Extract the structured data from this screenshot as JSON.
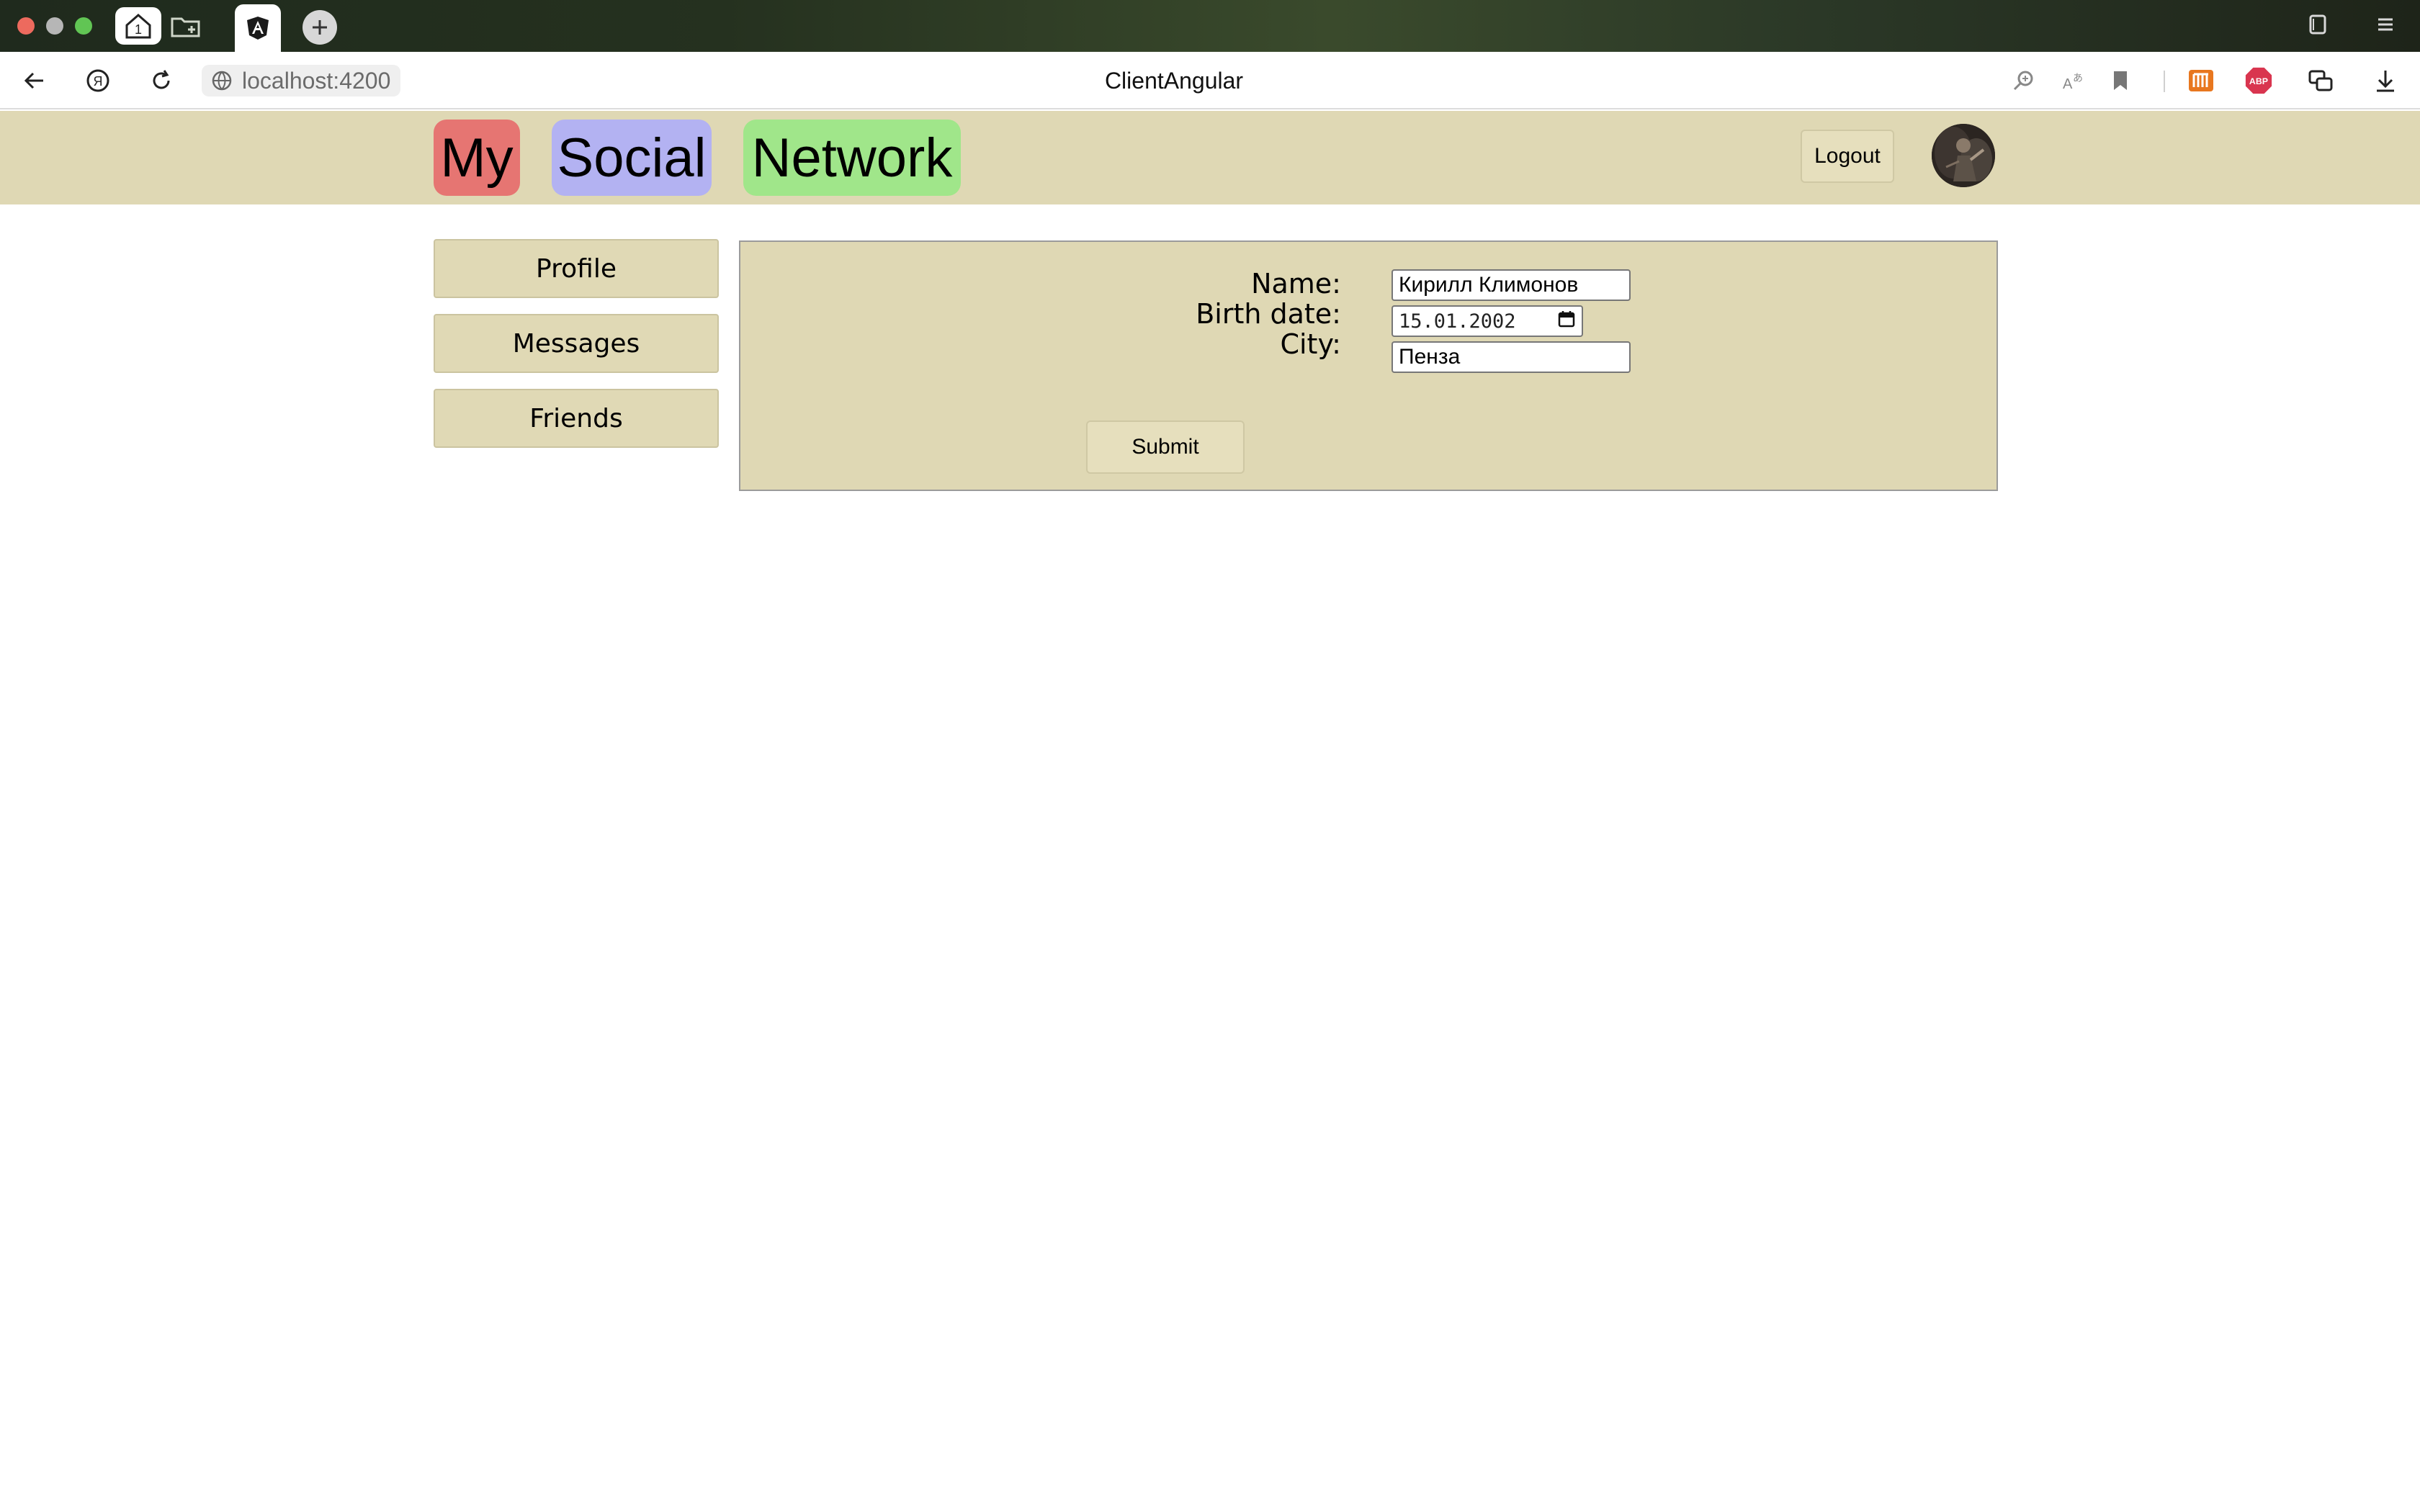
{
  "browser": {
    "url": "localhost:4200",
    "page_title": "ClientAngular",
    "tab_home_badge": "1",
    "extension_abp_label": "ABP"
  },
  "app": {
    "logo": {
      "word1": "My",
      "word2": "Social",
      "word3": "Network"
    },
    "colors": {
      "header_bg": "#dfd8b4",
      "logo_my": "#e67572",
      "logo_social": "#b3b2f2",
      "logo_network": "#a0e68a"
    },
    "logout_label": "Logout"
  },
  "sidebar": {
    "items": [
      {
        "label": "Profile"
      },
      {
        "label": "Messages"
      },
      {
        "label": "Friends"
      }
    ]
  },
  "profile_form": {
    "name_label": "Name:",
    "name_value": "Кирилл Климонов",
    "birth_label": "Birth date:",
    "birth_value": "15.01.2002",
    "city_label": "City:",
    "city_value": "Пенза",
    "submit_label": "Submit"
  }
}
